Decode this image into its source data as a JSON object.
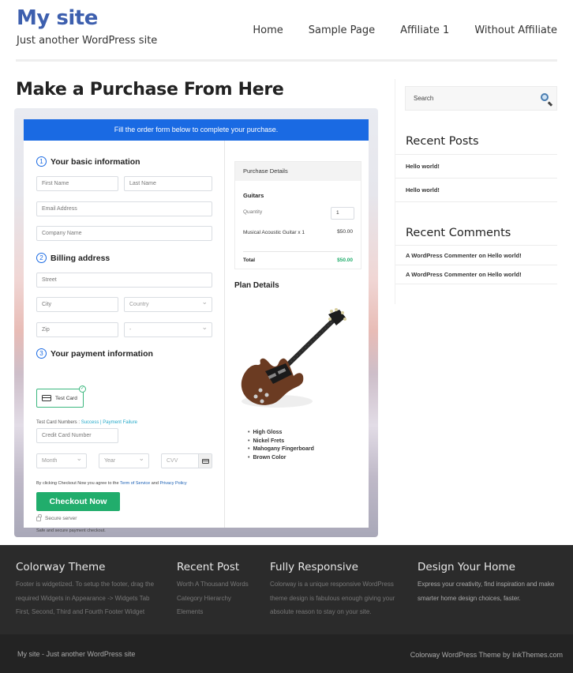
{
  "header": {
    "site_title": "My site",
    "tagline": "Just another WordPress site",
    "nav": [
      {
        "label": "Home"
      },
      {
        "label": "Sample Page"
      },
      {
        "label": "Affiliate 1"
      },
      {
        "label": "Without Affiliate"
      }
    ]
  },
  "page": {
    "title": "Make a Purchase From Here"
  },
  "form": {
    "banner": "Fill the order form below to complete your purchase.",
    "steps": [
      {
        "num": "1",
        "label": "Your basic information"
      },
      {
        "num": "2",
        "label": "Billing address"
      },
      {
        "num": "3",
        "label": "Your payment information"
      }
    ],
    "fields": {
      "first_name": "First Name",
      "last_name": "Last Name",
      "email": "Email Address",
      "company": "Company Name",
      "street": "Street",
      "city": "City",
      "country": "Country",
      "zip": "Zip",
      "state": "-",
      "card_number": "Credit Card Number",
      "month": "Month",
      "year": "Year",
      "cvv": "CVV"
    },
    "payment_method": "Test Card",
    "test_numbers_label": "Test Card Numbers : ",
    "test_success": "Success",
    "test_separator": " | ",
    "test_failure": "Payment Failure",
    "agree_prefix": "By clicking Checkout Now you agree to the ",
    "terms_link": "Term of Service",
    "agree_and": " and ",
    "privacy_link": "Privacy Policy",
    "checkout_label": "Checkout Now",
    "secure_label": "Secure server",
    "safe_label": "Safe and secure payment checkout."
  },
  "purchase": {
    "heading": "Purchase Details",
    "group": "Guitars",
    "quantity_label": "Quantity",
    "quantity_value": "1",
    "item": "Musical Acoustic Guitar x 1",
    "item_price": "$50.00",
    "total_label": "Total",
    "total_value": "$50.00",
    "plan_title": "Plan Details",
    "features": [
      "High Gloss",
      "Nickel Frets",
      "Mahogany Fingerboard",
      "Brown Color"
    ]
  },
  "sidebar": {
    "search_placeholder": "Search",
    "recent_posts_title": "Recent Posts",
    "recent_posts": [
      "Hello world!",
      "Hello world!"
    ],
    "recent_comments_title": "Recent Comments",
    "recent_comments": [
      "A WordPress Commenter on Hello world!",
      "A WordPress Commenter on Hello world!"
    ]
  },
  "footer": {
    "columns": [
      {
        "title": "Colorway Theme",
        "lines": [
          "Footer is widgetized. To setup the footer, drag the",
          "required Widgets in Appearance -> Widgets Tab",
          "First, Second, Third and Fourth Footer Widget"
        ]
      },
      {
        "title": "Recent Post",
        "lines": [
          "Worth A Thousand Words",
          "Category Hierarchy",
          "Elements"
        ]
      },
      {
        "title": "Fully Responsive",
        "lines": [
          "Colorway is a unique responsive WordPress",
          "theme design is fabulous enough giving your",
          "absolute reason to stay on your site."
        ]
      },
      {
        "title": "Design Your Home",
        "lines": [
          "Express your creativity, find inspiration and make",
          "smarter home design choices, faster."
        ]
      }
    ],
    "bottom_left": "My site - Just another WordPress site",
    "bottom_right": "Colorway WordPress Theme by InkThemes.com"
  }
}
